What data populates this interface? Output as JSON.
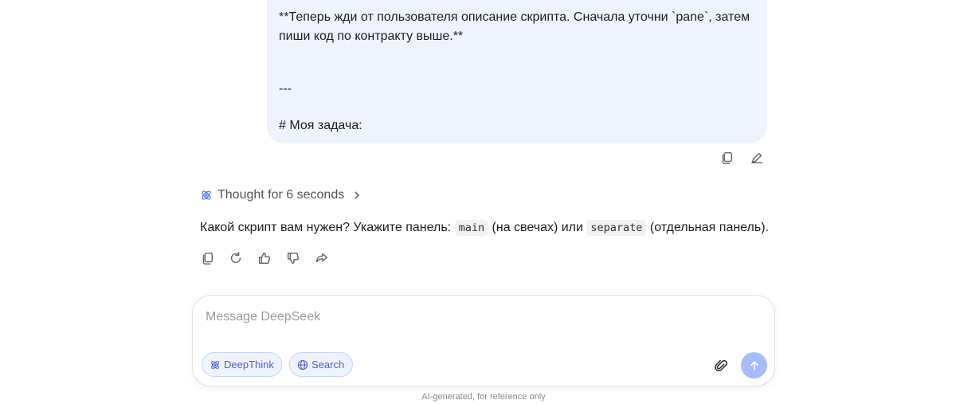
{
  "user_message": {
    "lines": [
      "**Теперь жди от пользователя описание скрипта. Сначала уточни `pane`, затем",
      "пиши код по контракту выше.**",
      "---",
      "# Моя задача:"
    ]
  },
  "thought": {
    "label": "Thought for 6 seconds"
  },
  "answer": {
    "part1": "Какой скрипт вам нужен? Укажите панель: ",
    "code1": "main",
    "part2": " (на свечах) или ",
    "code2": "separate",
    "part3": " (отдельная панель)."
  },
  "composer": {
    "placeholder": "Message DeepSeek",
    "deepthink_label": "DeepThink",
    "search_label": "Search"
  },
  "footer": {
    "text": "AI-generated, for reference only"
  },
  "colors": {
    "accent": "#4d6bfe",
    "bubble": "#eff3fe",
    "send": "#a7bcfb"
  }
}
